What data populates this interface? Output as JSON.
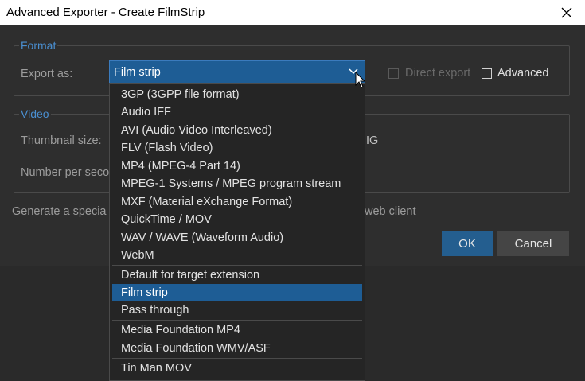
{
  "window": {
    "title": "Advanced Exporter - Create FilmStrip",
    "close_icon": "close-icon"
  },
  "format_group": {
    "legend": "Format",
    "export_as_label": "Export as:",
    "export_as_value": "Film strip",
    "direct_export_label": "Direct export",
    "direct_export_checked": false,
    "direct_export_enabled": false,
    "advanced_label": "Advanced",
    "advanced_checked": false
  },
  "video_group": {
    "legend": "Video",
    "thumbnail_size_label": "Thumbnail size:",
    "thumbnail_partial": "IG",
    "number_per_second_label": "Number per seco"
  },
  "generate_label_left": "Generate a specia",
  "generate_label_right": "web client",
  "buttons": {
    "ok": "OK",
    "cancel": "Cancel"
  },
  "dropdown": {
    "items": [
      {
        "label": "3GP (3GPP file format)"
      },
      {
        "label": "Audio IFF"
      },
      {
        "label": "AVI (Audio Video Interleaved)"
      },
      {
        "label": "FLV (Flash Video)"
      },
      {
        "label": "MP4 (MPEG-4 Part 14)"
      },
      {
        "label": "MPEG-1 Systems / MPEG program stream"
      },
      {
        "label": "MXF (Material eXchange Format)"
      },
      {
        "label": "QuickTime / MOV"
      },
      {
        "label": "WAV / WAVE (Waveform Audio)"
      },
      {
        "label": "WebM"
      },
      {
        "label": "Default for target extension"
      },
      {
        "label": "Film strip",
        "selected": true
      },
      {
        "label": "Pass through"
      },
      {
        "label": "Media Foundation MP4"
      },
      {
        "label": "Media Foundation WMV/ASF"
      },
      {
        "label": "Tin Man MOV"
      }
    ]
  },
  "colors": {
    "accent": "#1e5d95",
    "legend": "#4a8fd1",
    "ok_button": "#245e8f"
  }
}
